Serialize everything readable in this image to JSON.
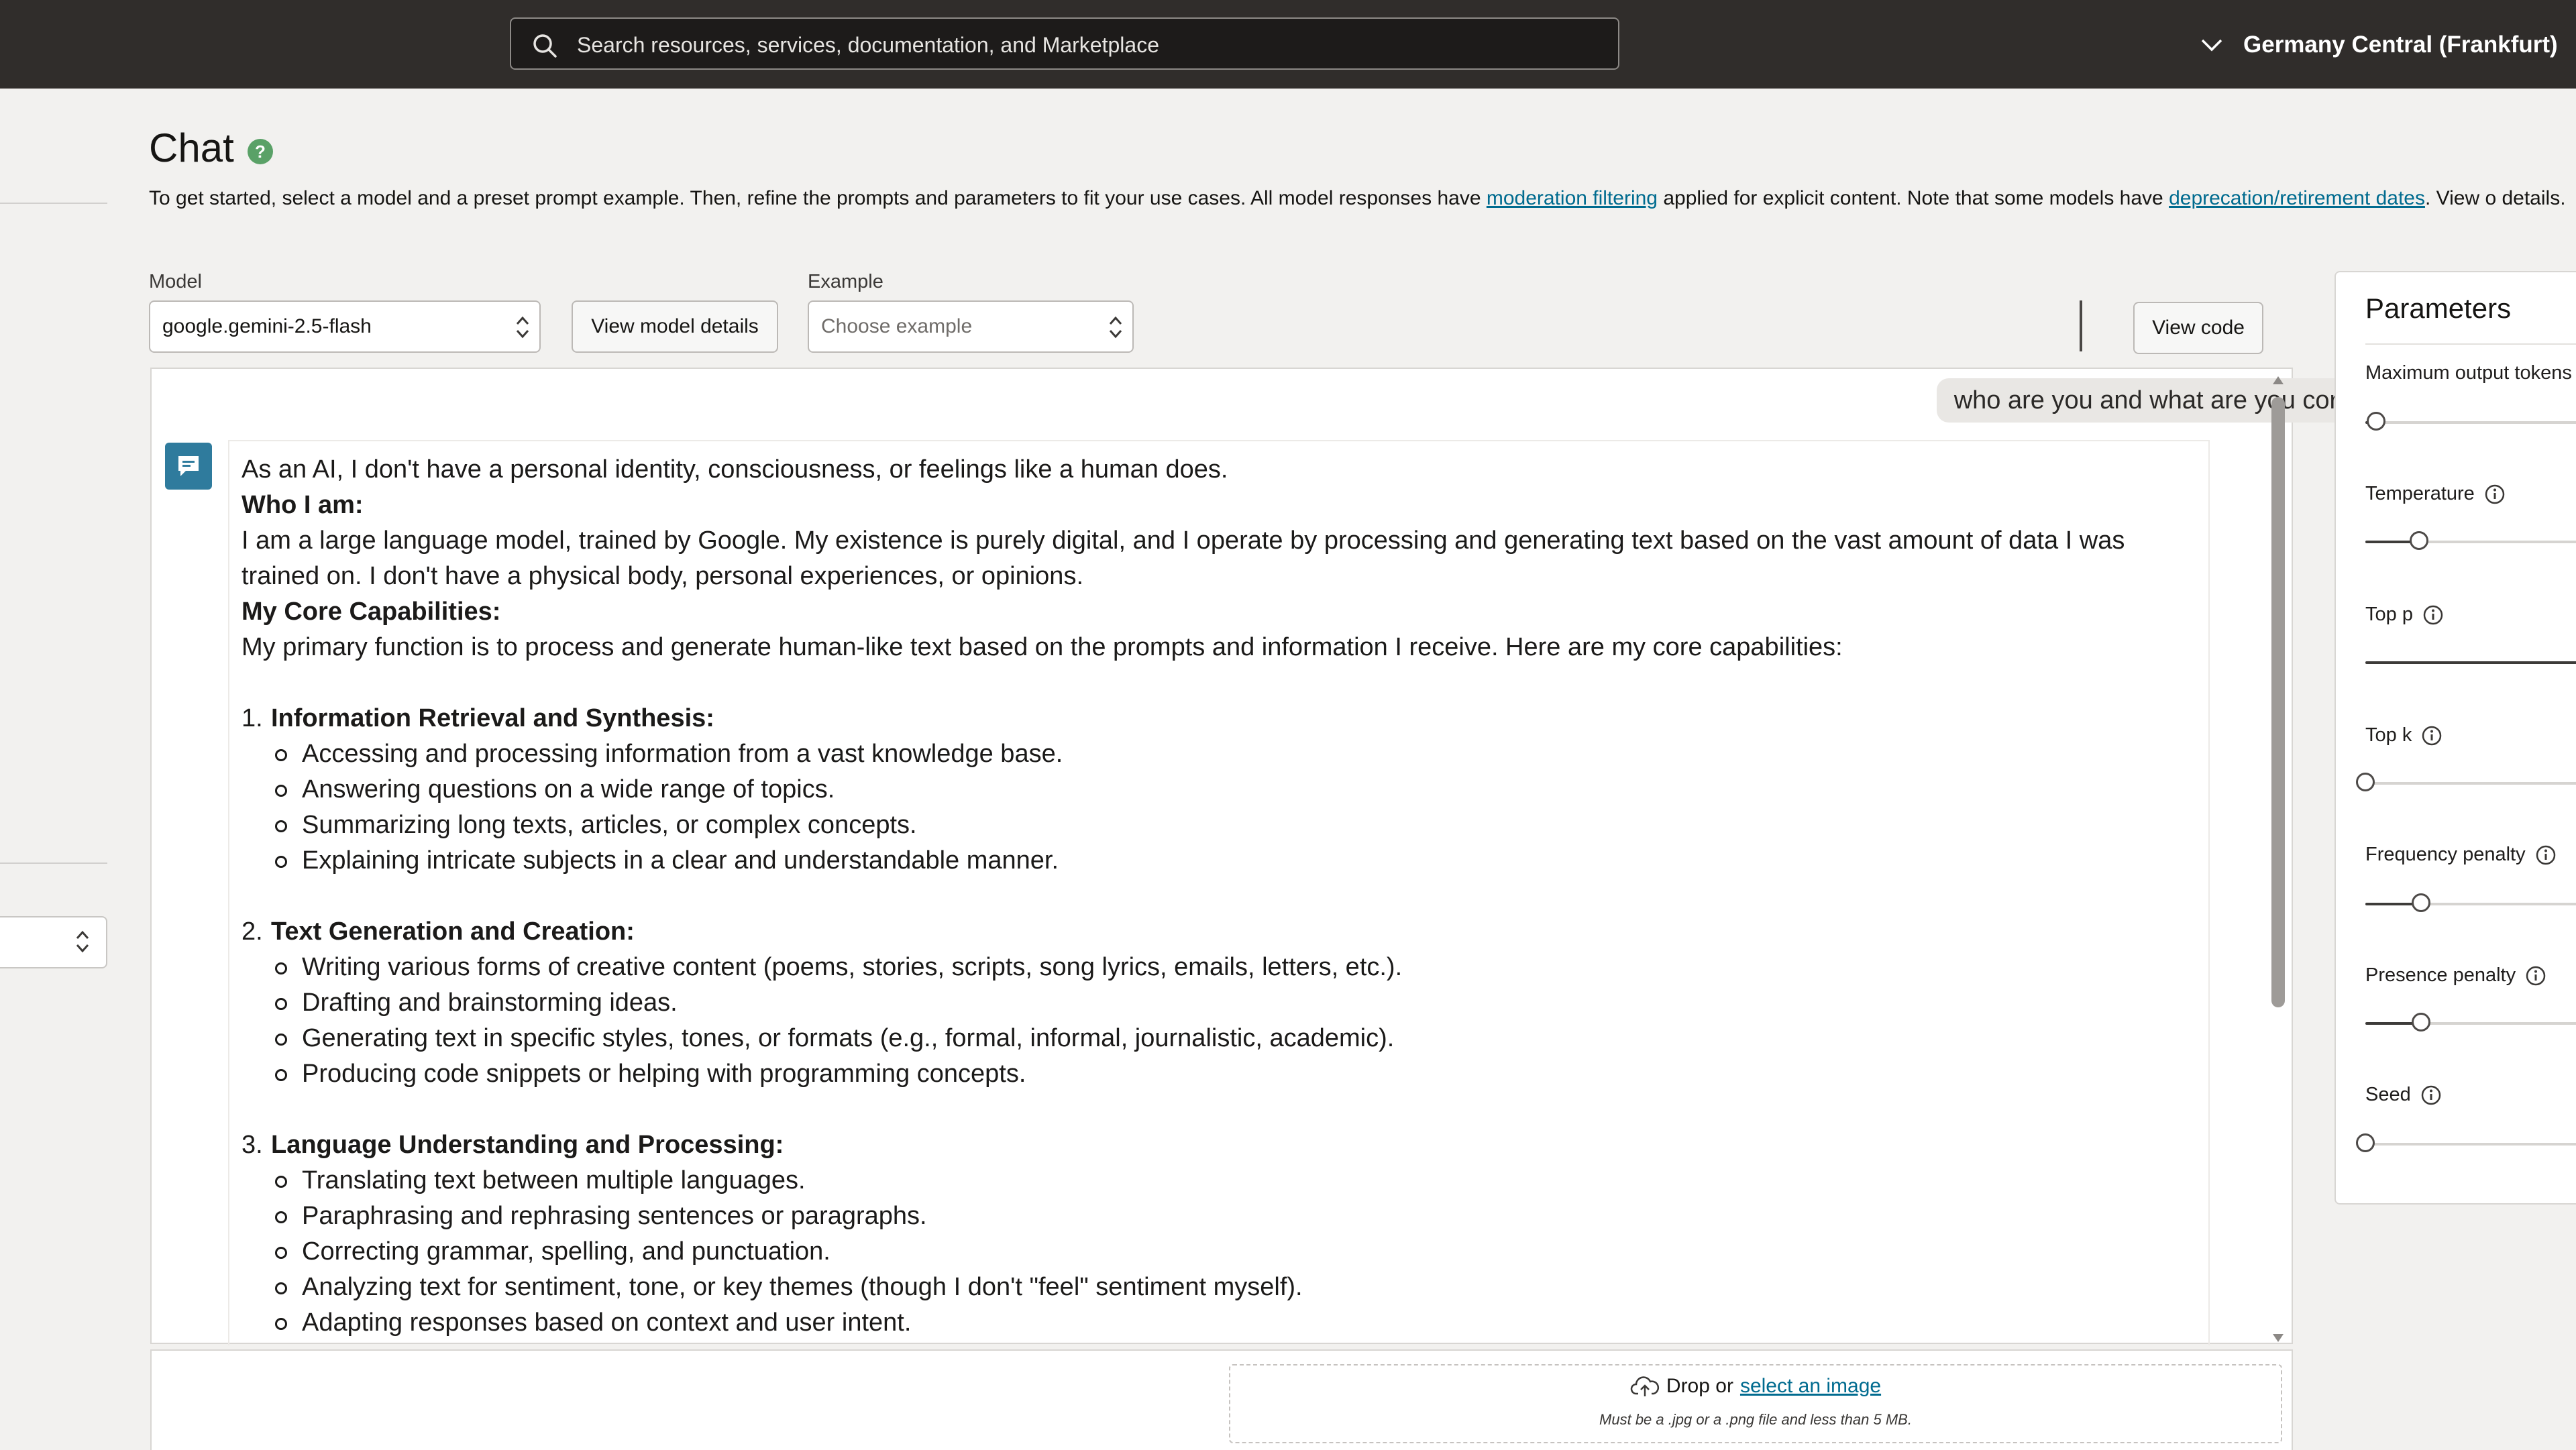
{
  "search": {
    "placeholder": "Search resources, services, documentation, and Marketplace"
  },
  "region": {
    "label": "Germany Central (Frankfurt)"
  },
  "header": {
    "title": "Chat",
    "intro_1": "To get started, select a model and a preset prompt example. Then, refine the prompts and parameters to fit your use cases. All model responses have ",
    "link_moderation": "moderation filtering",
    "intro_2": " applied for explicit content. Note that some models have ",
    "link_deprecation": "deprecation/retirement dates",
    "intro_3": ". View o details."
  },
  "controls": {
    "model_label": "Model",
    "model_value": "google.gemini-2.5-flash",
    "view_model_details": "View model details",
    "example_label": "Example",
    "example_placeholder": "Choose example",
    "view_code": "View code"
  },
  "chat": {
    "user_message": "who are you and what are you core capabilities?",
    "response": {
      "intro": "As an AI, I don't have a personal identity, consciousness, or feelings like a human does.",
      "who_heading": "Who I am:",
      "who_text": "I am a large language model, trained by Google. My existence is purely digital, and I operate by processing and generating text based on the vast amount of data I was trained on. I don't have a physical body, personal experiences, or opinions.",
      "core_heading": "My Core Capabilities:",
      "core_text": "My primary function is to process and generate human-like text based on the prompts and information I receive. Here are my core capabilities:",
      "sections": [
        {
          "number": "1.",
          "title": "Information Retrieval and Synthesis:",
          "items": [
            "Accessing and processing information from a vast knowledge base.",
            "Answering questions on a wide range of topics.",
            "Summarizing long texts, articles, or complex concepts.",
            "Explaining intricate subjects in a clear and understandable manner."
          ]
        },
        {
          "number": "2.",
          "title": "Text Generation and Creation:",
          "items": [
            "Writing various forms of creative content (poems, stories, scripts, song lyrics, emails, letters, etc.).",
            "Drafting and brainstorming ideas.",
            "Generating text in specific styles, tones, or formats (e.g., formal, informal, journalistic, academic).",
            "Producing code snippets or helping with programming concepts."
          ]
        },
        {
          "number": "3.",
          "title": "Language Understanding and Processing:",
          "items": [
            "Translating text between multiple languages.",
            "Paraphrasing and rephrasing sentences or paragraphs.",
            "Correcting grammar, spelling, and punctuation.",
            "Analyzing text for sentiment, tone, or key themes (though I don't \"feel\" sentiment myself).",
            "Adapting responses based on context and user intent."
          ]
        }
      ]
    }
  },
  "upload": {
    "drop_text": "Drop or",
    "select_link": "select an image",
    "note": "Must be a .jpg or a .png file and less than 5 MB."
  },
  "parameters": {
    "title": "Parameters",
    "items": [
      {
        "label": "Maximum output tokens",
        "level": 0.05,
        "has_info": false
      },
      {
        "label": "Temperature",
        "level": 0.25,
        "has_info": true
      },
      {
        "label": "Top p",
        "level": 1.0,
        "has_info": true
      },
      {
        "label": "Top k",
        "level": 0.0,
        "has_info": true
      },
      {
        "label": "Frequency penalty",
        "level": 0.26,
        "has_info": true
      },
      {
        "label": "Presence penalty",
        "level": 0.26,
        "has_info": true
      },
      {
        "label": "Seed",
        "level": 0.0,
        "has_info": true
      }
    ]
  },
  "colors": {
    "topbar": "#302d2b",
    "link": "#006b8f",
    "bot_icon": "#2f7b9d",
    "help_icon": "#5aa167"
  },
  "icons": {
    "search": "search-icon",
    "region_chevron": "chevron-down-icon",
    "help": "help-icon",
    "bot": "chat-bubble-icon",
    "upload": "cloud-upload-icon",
    "info": "info-icon"
  }
}
